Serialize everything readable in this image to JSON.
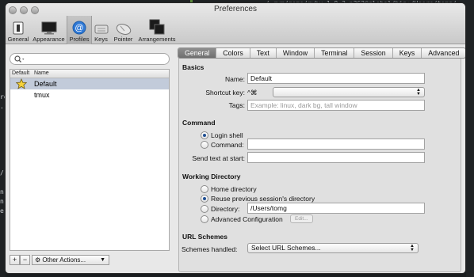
{
  "window": {
    "title": "Preferences"
  },
  "toolbar": {
    "items": [
      {
        "label": "General",
        "icon": "general-switch-icon"
      },
      {
        "label": "Appearance",
        "icon": "monitor-icon"
      },
      {
        "label": "Profiles",
        "icon": "at-sign-icon"
      },
      {
        "label": "Keys",
        "icon": "keyboard-icon"
      },
      {
        "label": "Pointer",
        "icon": "mouse-icon"
      },
      {
        "label": "Arrangements",
        "icon": "windows-icon"
      }
    ],
    "selected": "Profiles"
  },
  "sidebar": {
    "search_placeholder": "",
    "columns": [
      "Default",
      "Name"
    ],
    "profiles": [
      {
        "name": "Default",
        "is_default": true,
        "selected": true
      },
      {
        "name": "tmux",
        "is_default": false,
        "selected": false
      }
    ],
    "add_label": "+",
    "remove_label": "−",
    "actions_label": "Other Actions..."
  },
  "tabs": [
    "General",
    "Colors",
    "Text",
    "Window",
    "Terminal",
    "Session",
    "Keys",
    "Advanced"
  ],
  "selected_tab": "General",
  "basics": {
    "heading": "Basics",
    "name_label": "Name:",
    "name_value": "Default",
    "shortcut_label": "Shortcut key:",
    "shortcut_prefix": "^⌘",
    "shortcut_value": "",
    "tags_label": "Tags:",
    "tags_placeholder": "Example: linux, dark bg, tall window"
  },
  "command": {
    "heading": "Command",
    "login_shell_label": "Login shell",
    "command_label": "Command:",
    "command_value": "",
    "send_text_label": "Send text at start:",
    "send_text_value": "",
    "selected": "login_shell"
  },
  "working_directory": {
    "heading": "Working Directory",
    "home_label": "Home directory",
    "reuse_label": "Reuse previous session's directory",
    "directory_label": "Directory:",
    "directory_value": "/Users/tomg",
    "advanced_label": "Advanced Configuration",
    "edit_label": "Edit...",
    "selected": "reuse"
  },
  "url_schemes": {
    "heading": "URL Schemes",
    "handled_label": "Schemes handled:",
    "handled_value": "Select URL Schemes..."
  },
  "background": {
    "code_line": "…/.rvm/gems/ruby-1.9.3-p362@global/bin:/Users/tomg/…",
    "fragments": [
      "re",
      "...",
      "/",
      "n",
      "n",
      "e"
    ]
  }
}
